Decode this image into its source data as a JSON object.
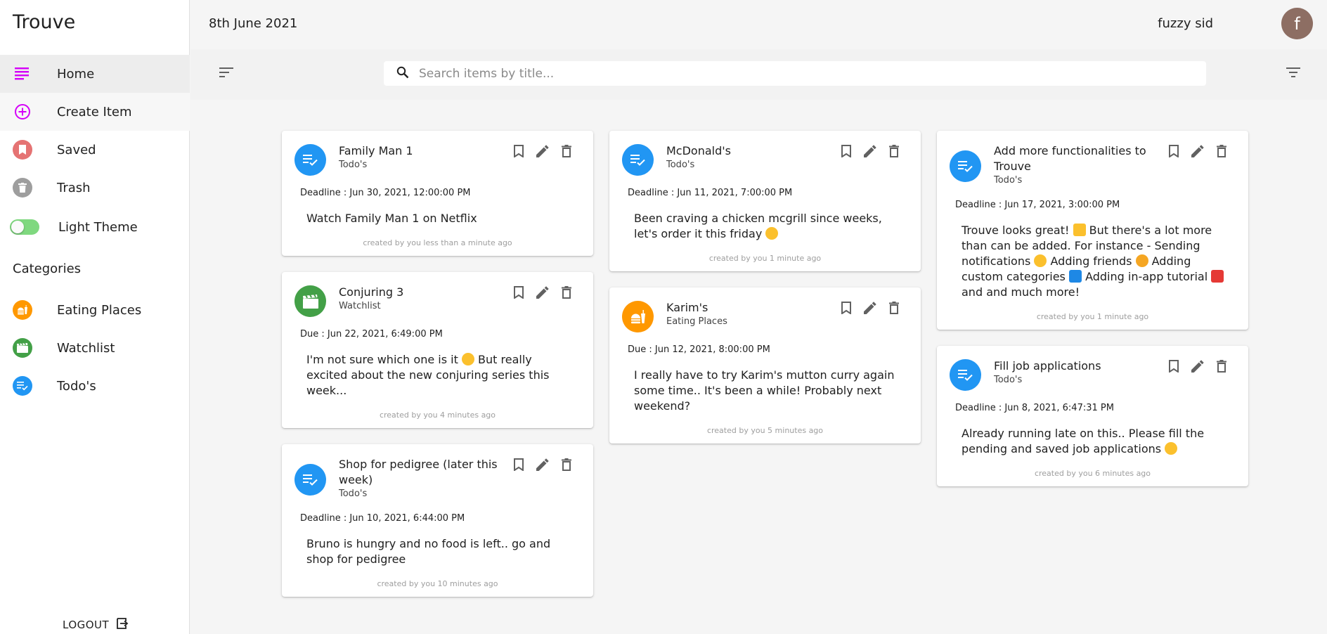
{
  "app": {
    "brand": "Trouve"
  },
  "sidebar": {
    "nav": [
      {
        "label": "Home",
        "icon": "home-list-icon"
      },
      {
        "label": "Create Item",
        "icon": "add-circle-icon"
      },
      {
        "label": "Saved",
        "icon": "bookmark-icon"
      },
      {
        "label": "Trash",
        "icon": "trash-icon"
      },
      {
        "label": "Light Theme",
        "icon": "theme-toggle"
      }
    ],
    "categories_heading": "Categories",
    "categories": [
      {
        "label": "Eating Places",
        "icon": "fastfood-icon",
        "color": "#ff9800"
      },
      {
        "label": "Watchlist",
        "icon": "movie-icon",
        "color": "#43a047"
      },
      {
        "label": "Todo's",
        "icon": "playlist-check-icon",
        "color": "#2196f3"
      }
    ],
    "logout": "LOGOUT"
  },
  "header": {
    "date": "8th June 2021",
    "username": "fuzzy sid",
    "avatar_letter": "f"
  },
  "search": {
    "placeholder": "Search items by title..."
  },
  "colors": {
    "todo": "#2196f3",
    "watchlist": "#43a047",
    "eating": "#ff9800",
    "accent": "#d500f9"
  },
  "cards": [
    {
      "title": "Family Man 1",
      "category": "Todo's",
      "deadline": "Deadline : Jun 30, 2021, 12:00:00 PM",
      "body": "Watch Family Man 1 on Netflix",
      "created": "created by you less than a minute ago"
    },
    {
      "title": "Conjuring 3",
      "category": "Watchlist",
      "deadline": "Due : Jun 22, 2021, 6:49:00 PM",
      "body_a": "I'm not sure which one is it",
      "body_b": "But really excited about the new conjuring series this week...",
      "created": "created by you 4 minutes ago"
    },
    {
      "title": "Shop for pedigree (later this week)",
      "category": "Todo's",
      "deadline": "Deadline : Jun 10, 2021, 6:44:00 PM",
      "body": "Bruno is hungry and no food is left.. go and shop for pedigree",
      "created": "created by you 10 minutes ago"
    },
    {
      "title": "McDonald's",
      "category": "Todo's",
      "deadline": "Deadline : Jun 11, 2021, 7:00:00 PM",
      "body": "Been craving a chicken mcgrill since weeks, let's order it this friday",
      "created": "created by you 1 minute ago"
    },
    {
      "title": "Karim's",
      "category": "Eating Places",
      "deadline": "Due : Jun 12, 2021, 8:00:00 PM",
      "body": "I really have to try Karim's mutton curry again some time.. It's been a while! Probably next weekend?",
      "created": "created by you 5 minutes ago"
    },
    {
      "title": "Add more functionalities to Trouve",
      "category": "Todo's",
      "deadline": "Deadline : Jun 17, 2021, 3:00:00 PM",
      "body_a": "Trouve looks great!",
      "body_b": "But there's a lot more than can be added. For instance - Sending notifications",
      "body_c": "Adding friends",
      "body_d": "Adding custom categories",
      "body_e": "Adding in-app tutorial",
      "body_f": "and and much more!",
      "created": "created by you 1 minute ago"
    },
    {
      "title": "Fill job applications",
      "category": "Todo's",
      "deadline": "Deadline : Jun 8, 2021, 6:47:31 PM",
      "body": "Already running late on this.. Please fill the pending and saved job applications",
      "created": "created by you 6 minutes ago"
    }
  ]
}
